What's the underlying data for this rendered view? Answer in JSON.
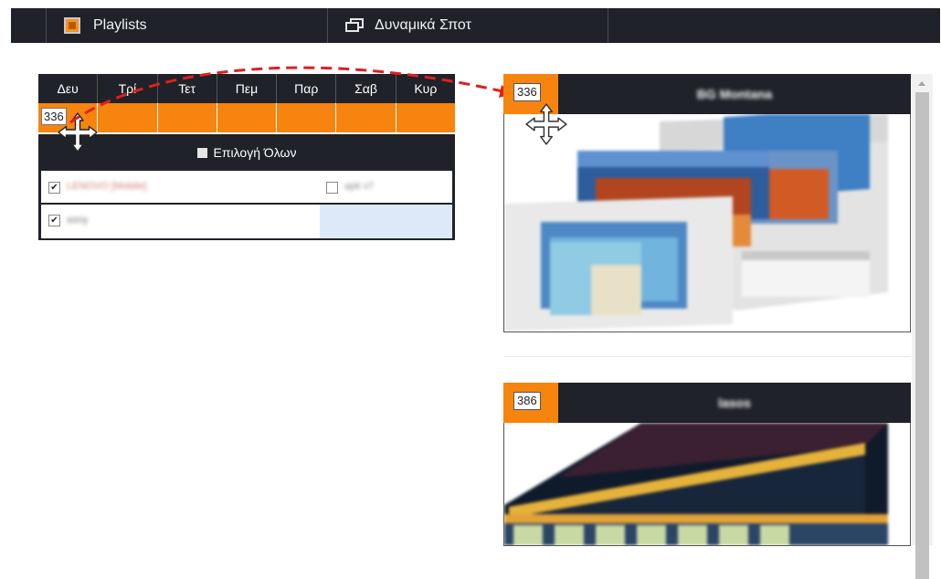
{
  "nav": {
    "items": [
      {
        "label": "Playlists",
        "icon": "playlist-icon"
      },
      {
        "label": "Δυναμικά Σποτ",
        "icon": "windows-icon"
      }
    ]
  },
  "schedule": {
    "days": [
      "Δευ",
      "Τρί",
      "Τετ",
      "Πεμ",
      "Παρ",
      "Σαβ",
      "Κυρ"
    ],
    "dragged_badge": "336",
    "select_all": "Επιλογή Όλων",
    "devices": [
      {
        "label": "LENOVO [Mobile]",
        "checked": true
      },
      {
        "label": "apk v7",
        "checked": false
      },
      {
        "label": "sony",
        "checked": true
      }
    ]
  },
  "cards": [
    {
      "id": "336",
      "title": "BG Montana"
    },
    {
      "id": "386",
      "title": "lasos"
    }
  ],
  "colors": {
    "accent": "#f7840f",
    "dark": "#1f2228",
    "arrow": "#e01f1f",
    "highlight": "#dde9f9"
  }
}
